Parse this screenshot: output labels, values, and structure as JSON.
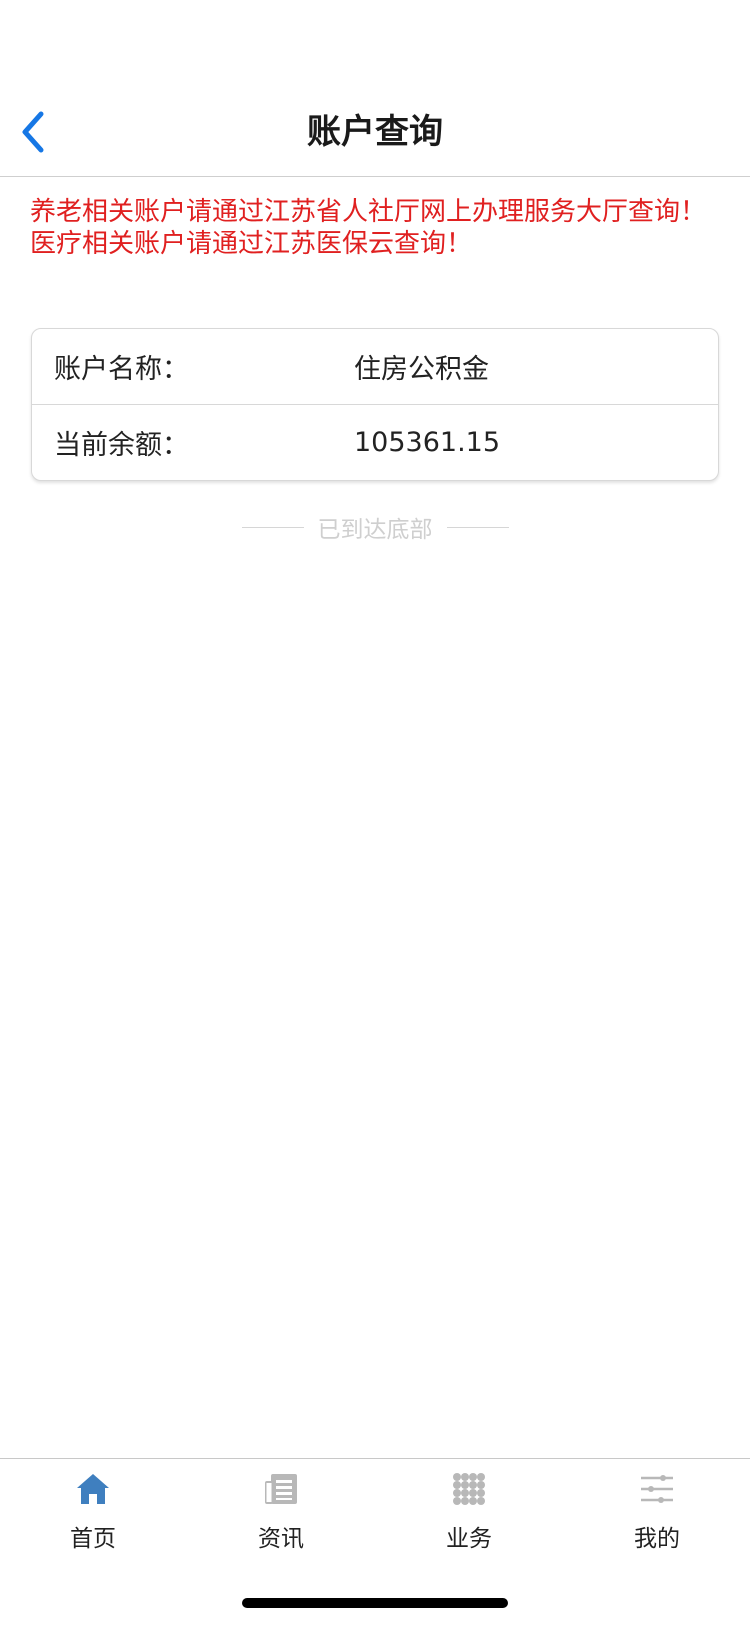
{
  "header": {
    "title": "账户查询",
    "back_icon": "chevron-left-icon",
    "accent_color": "#1677e5"
  },
  "notice": {
    "line1": "养老相关账户请通过江苏省人社厅网上办理服务大厅查询！",
    "line2": "医疗相关账户请通过江苏医保云查询！",
    "color": "#e02020"
  },
  "account": {
    "rows": [
      {
        "label": "账户名称：",
        "value": "住房公积金"
      },
      {
        "label": "当前余额：",
        "value": "105361.15"
      }
    ]
  },
  "footer_hint": "已到达底部",
  "tabbar": {
    "tabs": [
      {
        "label": "首页",
        "icon": "home-icon",
        "active": true
      },
      {
        "label": "资讯",
        "icon": "news-icon",
        "active": false
      },
      {
        "label": "业务",
        "icon": "grid-icon",
        "active": false
      },
      {
        "label": "我的",
        "icon": "settings-sliders-icon",
        "active": false
      }
    ]
  }
}
